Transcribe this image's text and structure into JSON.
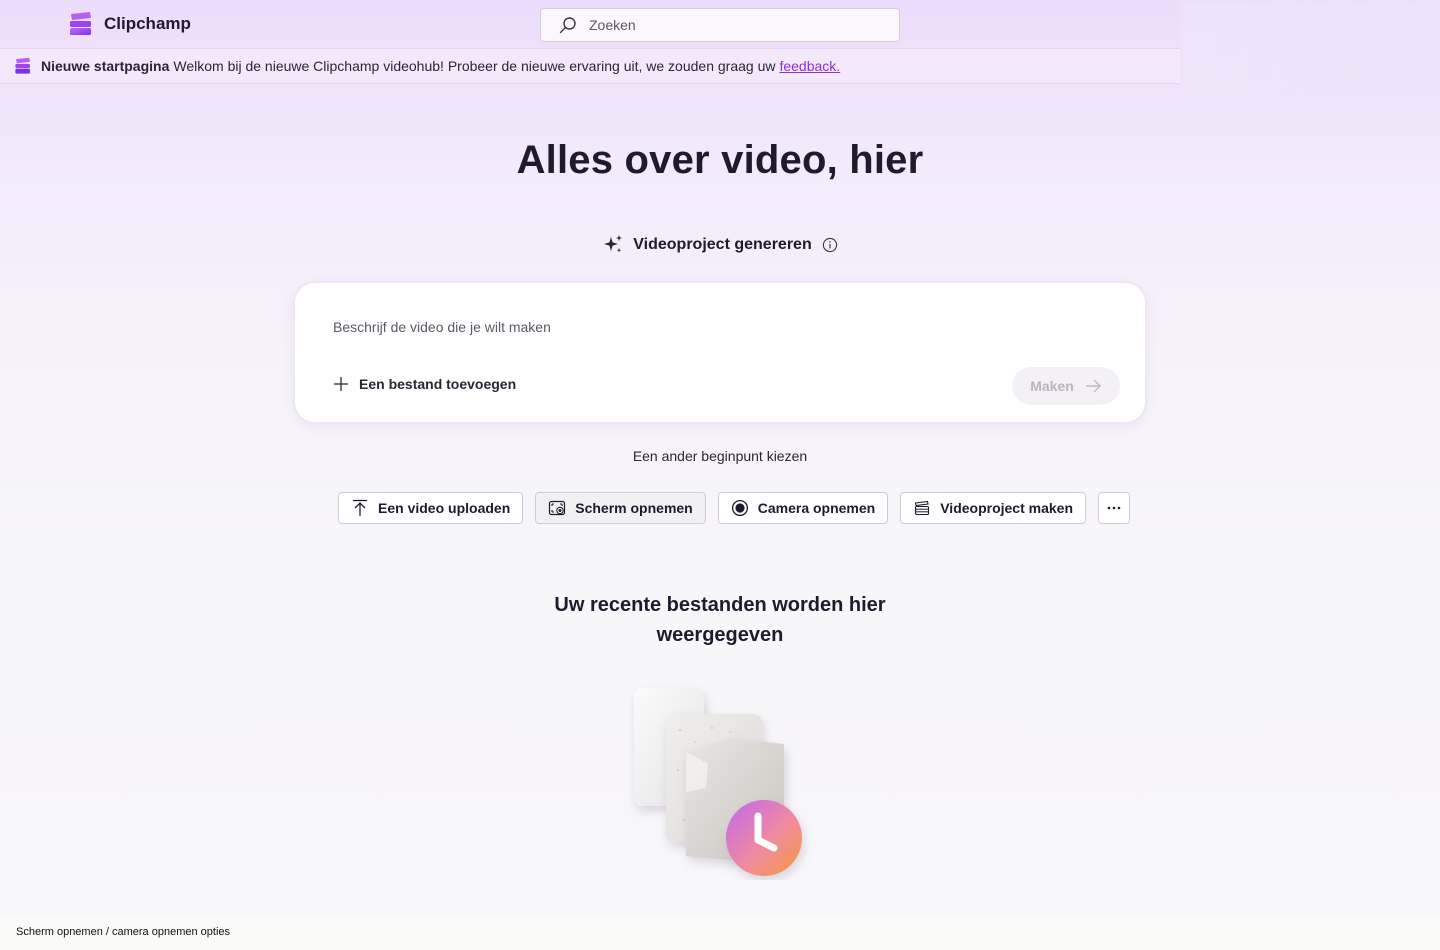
{
  "app": {
    "brand": "Clipchamp"
  },
  "search": {
    "placeholder": "Zoeken"
  },
  "banner": {
    "title": "Nieuwe startpagina",
    "message": "Welkom bij de nieuwe Clipchamp videohub! Probeer de nieuwe ervaring uit, we zouden graag uw",
    "link": "feedback."
  },
  "hero": {
    "title": "Alles over video, hier",
    "generate_label": "Videoproject genereren"
  },
  "prompt": {
    "placeholder": "Beschrijf de video die je wilt maken",
    "add_file": "Een bestand toevoegen",
    "make": "Maken"
  },
  "alternatives": {
    "label": "Een ander beginpunt kiezen",
    "buttons": [
      {
        "label": "Een video uploaden",
        "icon": "upload-icon"
      },
      {
        "label": "Scherm opnemen",
        "icon": "screen-record-icon"
      },
      {
        "label": "Camera opnemen",
        "icon": "camera-record-icon"
      },
      {
        "label": "Videoproject maken",
        "icon": "video-project-icon"
      }
    ],
    "more_icon": "more-icon"
  },
  "recent": {
    "line1": "Uw recente bestanden worden hier",
    "line2": "weergegeven"
  },
  "status": {
    "text": "Scherm opnemen / camera opnemen opties"
  },
  "colors": {
    "accent": "#8c2fd2",
    "background_top": "#ecdcfb",
    "text": "#1f1b2d"
  }
}
